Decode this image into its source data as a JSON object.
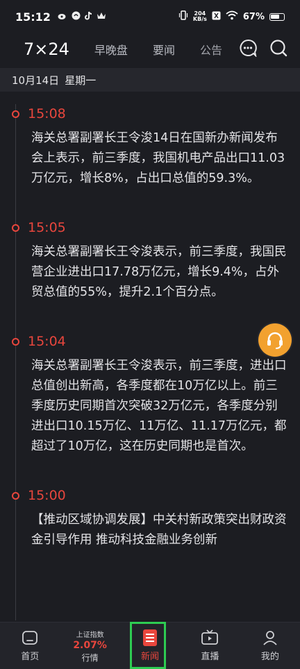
{
  "status_bar": {
    "time": "15:12",
    "net_speed_top": "204",
    "net_speed_bottom": "KB/s",
    "battery": "67%",
    "left_icons": [
      "weibo-icon",
      "music-icon",
      "tiktok-icon",
      "crown-icon"
    ]
  },
  "top_nav": {
    "main": "7×24",
    "tabs": [
      "早晚盘",
      "要闻",
      "公告"
    ]
  },
  "date_bar": {
    "date": "10月14日",
    "weekday": "星期一"
  },
  "feed": [
    {
      "time": "15:08",
      "text": "海关总署副署长王令浚14日在国新办新闻发布会上表示，前三季度，我国机电产品出口11.03万亿元，增长8%，占出口总值的59.3%。"
    },
    {
      "time": "15:05",
      "text": "海关总署副署长王令浚表示，前三季度，我国民营企业进出口17.78万亿元，增长9.4%，占外贸总值的55%，提升2.1个百分点。"
    },
    {
      "time": "15:04",
      "text": "海关总署副署长王令浚表示，前三季度，进出口总值创出新高，各季度都在10万亿以上。前三季度历史同期首次突破32万亿元，各季度分别进出口10.15万亿、11万亿、11.17万亿元，都超过了10万亿，这在历史同期也是首次。"
    },
    {
      "time": "15:00",
      "text": "【推动区域协调发展】中关村新政策突出财政资金引导作用 推动科技金融业务创新"
    }
  ],
  "bottom_nav": {
    "home": "首页",
    "market_name": "上证指数",
    "market_value": "2.07%",
    "market_label": "行情",
    "news": "新闻",
    "live": "直播",
    "mine": "我的"
  },
  "colors": {
    "background": "#1c1d22",
    "accent_red": "#e8463d",
    "float_orange": "#f2a12f",
    "active_frame_green": "#2ecc52"
  }
}
